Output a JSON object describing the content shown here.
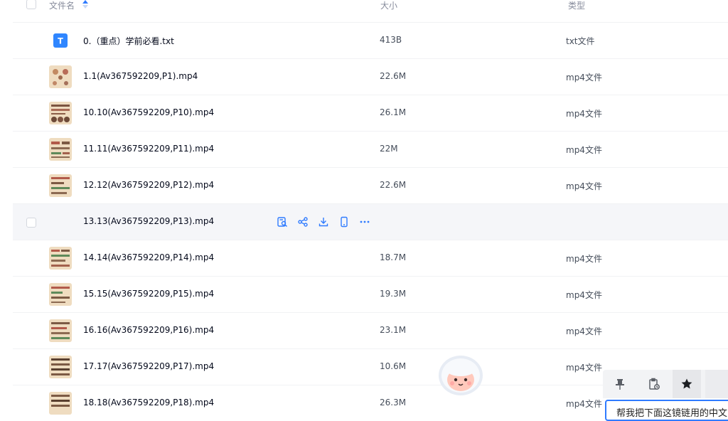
{
  "header": {
    "col_name": "文件名",
    "col_size": "大小",
    "col_type": "类型"
  },
  "rows": [
    {
      "name": "0.（重点）学前必看.txt",
      "size": "413B",
      "type": "txt文件",
      "thumb": "txt-icon"
    },
    {
      "name": "1.1(Av367592209,P1).mp4",
      "size": "22.6M",
      "type": "mp4文件",
      "thumb": "video-thumbnail"
    },
    {
      "name": "10.10(Av367592209,P10).mp4",
      "size": "26.1M",
      "type": "mp4文件",
      "thumb": "video-thumbnail"
    },
    {
      "name": "11.11(Av367592209,P11).mp4",
      "size": "22M",
      "type": "mp4文件",
      "thumb": "video-thumbnail"
    },
    {
      "name": "12.12(Av367592209,P12).mp4",
      "size": "22.6M",
      "type": "mp4文件",
      "thumb": "video-thumbnail"
    },
    {
      "name": "13.13(Av367592209,P13).mp4",
      "size": "",
      "type": "",
      "thumb": "",
      "hovered": true
    },
    {
      "name": "14.14(Av367592209,P14).mp4",
      "size": "18.7M",
      "type": "mp4文件",
      "thumb": "video-thumbnail"
    },
    {
      "name": "15.15(Av367592209,P15).mp4",
      "size": "19.3M",
      "type": "mp4文件",
      "thumb": "video-thumbnail"
    },
    {
      "name": "16.16(Av367592209,P16).mp4",
      "size": "23.1M",
      "type": "mp4文件",
      "thumb": "video-thumbnail"
    },
    {
      "name": "17.17(Av367592209,P17).mp4",
      "size": "10.6M",
      "type": "mp4文件",
      "thumb": "video-thumbnail"
    },
    {
      "name": "18.18(Av367592209,P18).mp4",
      "size": "26.3M",
      "type": "mp4文件",
      "thumb": "video-thumbnail"
    }
  ],
  "hover_actions": [
    "preview-icon",
    "share-icon",
    "download-icon",
    "phone-icon",
    "more-icon"
  ],
  "floating_toolbar": {
    "buttons": [
      "pin-icon",
      "clipboard-history-icon",
      "star-icon"
    ]
  },
  "input": {
    "value": "帮我把下面这镜链用的中文"
  },
  "colors": {
    "accent": "#2f7bff",
    "text": "#03081a",
    "muted": "#878c9c",
    "hover_row": "#f5f6f9"
  }
}
